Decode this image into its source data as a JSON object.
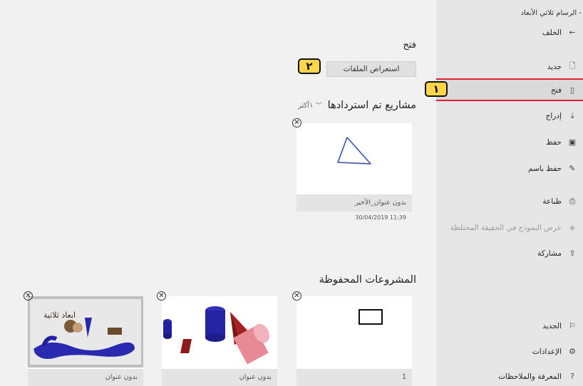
{
  "app_title": "- الرسام ثلاثي الأبعاد",
  "sidebar": {
    "back": {
      "label": "الخلف",
      "icon": "arrow-left-icon"
    },
    "items": [
      {
        "label": "جديد",
        "icon": "new-file-icon"
      },
      {
        "label": "فتح",
        "icon": "open-icon"
      },
      {
        "label": "إدراج",
        "icon": "insert-icon"
      },
      {
        "label": "حفظ",
        "icon": "save-icon"
      },
      {
        "label": "حفظ باسم",
        "icon": "save-as-icon"
      },
      {
        "label": "طباعة",
        "icon": "print-icon"
      },
      {
        "label": "عرض النموذج في الحقيقة المختلطة",
        "icon": "mixed-reality-icon"
      },
      {
        "label": "مشاركة",
        "icon": "share-icon"
      }
    ],
    "bottom_items": [
      {
        "label": "الجديد",
        "icon": "flag-icon"
      },
      {
        "label": "الإعدادات",
        "icon": "settings-icon"
      },
      {
        "label": "المعرفة والملاحظات",
        "icon": "help-icon"
      }
    ]
  },
  "callouts": {
    "one": "١",
    "two": "٢"
  },
  "main": {
    "open_title": "فتح",
    "browse_button": "استعراض الملفات",
    "recovered_title": "مشاريع تم استردادها",
    "more_link": "١أكثر",
    "recovered_card": {
      "name": "بدون عنوان_الأخير",
      "date": "30/04/2019 11:39"
    },
    "saved_title": "المشروعات المحفوظة",
    "saved_cards": [
      {
        "name": "1"
      },
      {
        "name": "بدون عنوان"
      },
      {
        "name": "بدون عنوان",
        "thumb_text": "ابعاد ثلاثية"
      }
    ]
  }
}
